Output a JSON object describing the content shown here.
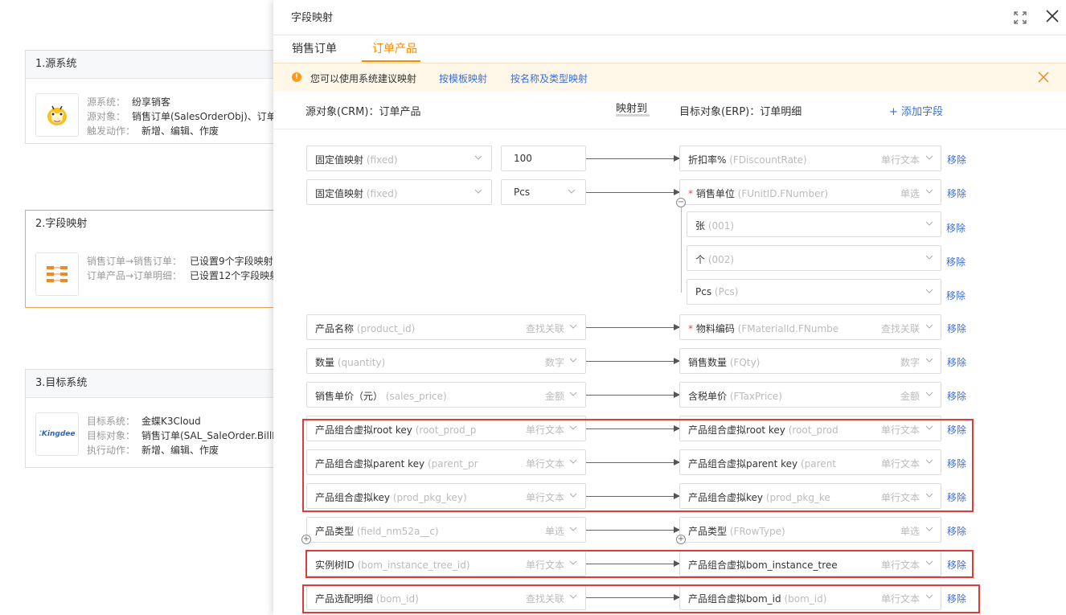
{
  "background": {
    "source": {
      "title": "1.源系统",
      "lines": [
        {
          "k": "源系统：",
          "v": "纷享销客"
        },
        {
          "k": "源对象：",
          "v": "销售订单(SalesOrderObj)、订单产"
        },
        {
          "k": "触发动作：",
          "v": "新增、编辑、作废"
        }
      ]
    },
    "mapping": {
      "title": "2.字段映射",
      "lines": [
        {
          "k": "销售订单→销售订单：",
          "v": "已设置9个字段映射"
        },
        {
          "k": "订单产品→订单明细：",
          "v": "已设置12个字段映射"
        }
      ]
    },
    "target": {
      "title": "3.目标系统",
      "logo_text": "Kingdee",
      "lines": [
        {
          "k": "目标系统：",
          "v": "金蝶K3Cloud"
        },
        {
          "k": "目标对象：",
          "v": "销售订单(SAL_SaleOrder.BillHe"
        },
        {
          "k": "执行动作：",
          "v": "新增、编辑、作废"
        }
      ]
    }
  },
  "drawer": {
    "title": "字段映射",
    "tabs": [
      {
        "label": "销售订单",
        "active": false
      },
      {
        "label": "订单产品",
        "active": true
      }
    ],
    "notice": {
      "text": "您可以使用系统建议映射",
      "link1": "按模板映射",
      "link2": "按名称及类型映射"
    },
    "header": {
      "source": "源对象(CRM)：订单产品",
      "map_label": "映射到",
      "target": "目标对象(ERP)：订单明细",
      "add_field": "+ 添加字段"
    },
    "remove_label": "移除",
    "fixed_rows": [
      {
        "src": "固定值映射",
        "src_api": "(fixed)",
        "value": "100",
        "tgt": "折扣率%",
        "tgt_api": "(FDiscountRate)",
        "tgt_type": "单行文本",
        "required": false
      },
      {
        "src": "固定值映射",
        "src_api": "(fixed)",
        "value": "Pcs",
        "tgt": "销售单位",
        "tgt_api": "(FUnitID.FNumber)",
        "tgt_type": "单选",
        "required": true
      }
    ],
    "options": [
      {
        "label": "张",
        "api": "(001)"
      },
      {
        "label": "个",
        "api": "(002)"
      },
      {
        "label": "Pcs",
        "api": "(Pcs)"
      }
    ],
    "rows": [
      {
        "src": "产品名称",
        "src_api": "(product_id)",
        "src_type": "查找关联",
        "tgt": "物料编码",
        "tgt_api": "(FMaterialId.FNumbe",
        "tgt_type": "查找关联",
        "required": true
      },
      {
        "src": "数量",
        "src_api": "(quantity)",
        "src_type": "数字",
        "tgt": "销售数量",
        "tgt_api": "(FQty)",
        "tgt_type": "数字",
        "required": false
      },
      {
        "src": "销售单价（元）",
        "src_api": "(sales_price)",
        "src_type": "金额",
        "tgt": "含税单价",
        "tgt_api": "(FTaxPrice)",
        "tgt_type": "金额",
        "required": false
      },
      {
        "src": "产品组合虚拟root key",
        "src_api": "(root_prod_p",
        "src_type": "单行文本",
        "tgt": "产品组合虚拟root key",
        "tgt_api": "(root_prod",
        "tgt_type": "单行文本",
        "required": false
      },
      {
        "src": "产品组合虚拟parent key",
        "src_api": "(parent_pr",
        "src_type": "单行文本",
        "tgt": "产品组合虚拟parent key",
        "tgt_api": "(parent",
        "tgt_type": "单行文本",
        "required": false
      },
      {
        "src": "产品组合虚拟key",
        "src_api": "(prod_pkg_key)",
        "src_type": "单行文本",
        "tgt": "产品组合虚拟key",
        "tgt_api": "(prod_pkg_ke",
        "tgt_type": "单行文本",
        "required": false
      },
      {
        "src": "产品类型",
        "src_api": "(field_nm52a__c)",
        "src_type": "单选",
        "tgt": "产品类型",
        "tgt_api": "(FRowType)",
        "tgt_type": "单选",
        "required": false
      },
      {
        "src": "实例树ID",
        "src_api": "(bom_instance_tree_id)",
        "src_type": "单行文本",
        "tgt": "产品组合虚拟bom_instance_tree",
        "tgt_api": "",
        "tgt_type": "单行文本",
        "required": false
      },
      {
        "src": "产品选配明细",
        "src_api": "(bom_id)",
        "src_type": "查找关联",
        "tgt": "产品组合虚拟bom_id",
        "tgt_api": "(bom_id)",
        "tgt_type": "单行文本",
        "required": false
      }
    ]
  },
  "colors": {
    "accent": "#ff8a00",
    "link": "#3a6fd8",
    "highlight": "#e03a3a"
  }
}
